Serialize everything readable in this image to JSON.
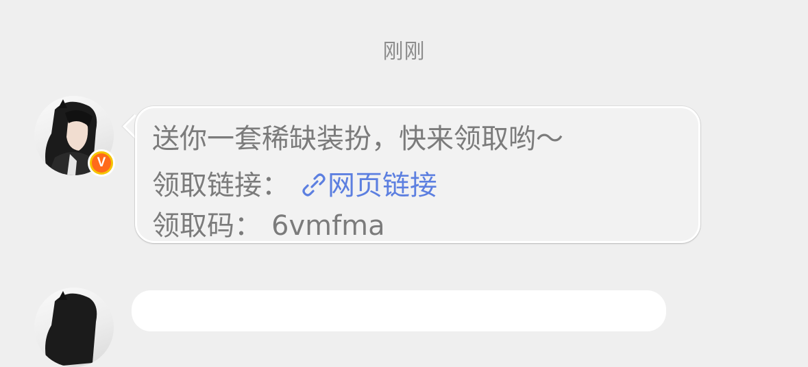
{
  "chat": {
    "timestamp": "刚刚",
    "message": {
      "line1": "送你一套稀缺装扮，快来领取哟～",
      "link_label": "领取链接：",
      "link_text": "网页链接",
      "code_label": "领取码：",
      "code_value": "6vmfma",
      "link_icon": "link-icon"
    },
    "sender_badge": "V",
    "colors": {
      "background": "#efefef",
      "bubble": "#f2f2f2",
      "text": "#7b7b7b",
      "link": "#5c7fe0",
      "badge": "#f5c400"
    }
  }
}
